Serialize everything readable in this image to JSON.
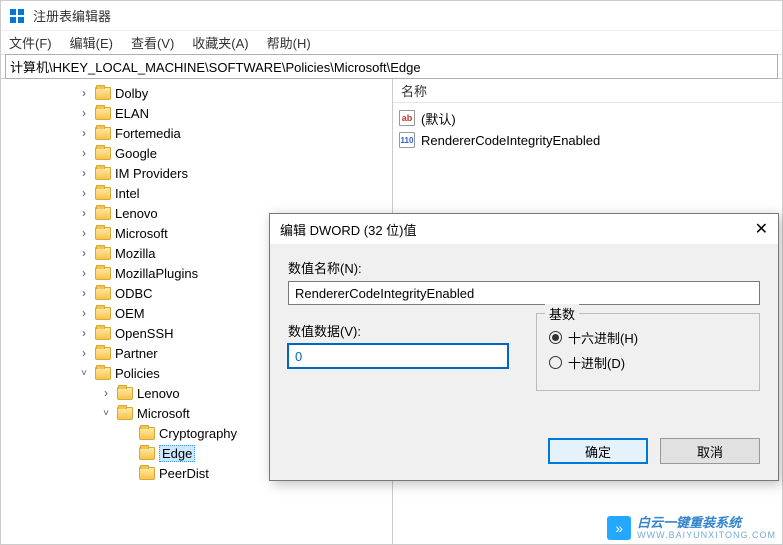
{
  "window": {
    "title": "注册表编辑器"
  },
  "menu": {
    "file": "文件(F)",
    "edit": "编辑(E)",
    "view": "查看(V)",
    "fav": "收藏夹(A)",
    "help": "帮助(H)"
  },
  "address": "计算机\\HKEY_LOCAL_MACHINE\\SOFTWARE\\Policies\\Microsoft\\Edge",
  "tree": {
    "items": [
      {
        "indent": 76,
        "exp": "closed",
        "label": "Dolby"
      },
      {
        "indent": 76,
        "exp": "closed",
        "label": "ELAN"
      },
      {
        "indent": 76,
        "exp": "closed",
        "label": "Fortemedia"
      },
      {
        "indent": 76,
        "exp": "closed",
        "label": "Google"
      },
      {
        "indent": 76,
        "exp": "closed",
        "label": "IM Providers"
      },
      {
        "indent": 76,
        "exp": "closed",
        "label": "Intel"
      },
      {
        "indent": 76,
        "exp": "closed",
        "label": "Lenovo"
      },
      {
        "indent": 76,
        "exp": "closed",
        "label": "Microsoft"
      },
      {
        "indent": 76,
        "exp": "closed",
        "label": "Mozilla"
      },
      {
        "indent": 76,
        "exp": "closed",
        "label": "MozillaPlugins"
      },
      {
        "indent": 76,
        "exp": "closed",
        "label": "ODBC"
      },
      {
        "indent": 76,
        "exp": "closed",
        "label": "OEM"
      },
      {
        "indent": 76,
        "exp": "closed",
        "label": "OpenSSH"
      },
      {
        "indent": 76,
        "exp": "closed",
        "label": "Partner"
      },
      {
        "indent": 76,
        "exp": "open",
        "label": "Policies"
      },
      {
        "indent": 98,
        "exp": "closed",
        "label": "Lenovo"
      },
      {
        "indent": 98,
        "exp": "open",
        "label": "Microsoft"
      },
      {
        "indent": 120,
        "exp": "none",
        "label": "Cryptography"
      },
      {
        "indent": 120,
        "exp": "none",
        "label": "Edge",
        "selected": true
      },
      {
        "indent": 120,
        "exp": "none",
        "label": "PeerDist"
      }
    ]
  },
  "list": {
    "header": "名称",
    "rows": [
      {
        "icon": "ab",
        "label": "(默认)"
      },
      {
        "icon": "bin",
        "label": "RendererCodeIntegrityEnabled"
      }
    ]
  },
  "dialog": {
    "title": "编辑 DWORD (32 位)值",
    "name_label": "数值名称(N):",
    "name_value": "RendererCodeIntegrityEnabled",
    "data_label": "数值数据(V):",
    "data_value": "0",
    "base_label": "基数",
    "radio_hex": "十六进制(H)",
    "radio_dec": "十进制(D)",
    "ok": "确定",
    "cancel": "取消"
  },
  "watermark": {
    "line1": "白云一键重装系统",
    "line2": "WWW.BAIYUNXITONG.COM"
  }
}
